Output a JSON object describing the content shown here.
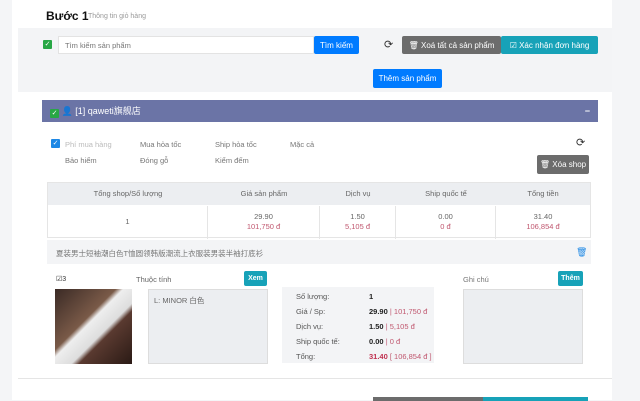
{
  "step": {
    "title": "Bước 1",
    "subtitle": "Thông tin giỏ hàng"
  },
  "search": {
    "placeholder": "Tìm kiếm sản phẩm",
    "button": "Tìm kiếm"
  },
  "toolbar": {
    "delete_all": "Xoá tất cả sản phẩm",
    "confirm": "Xác nhận đơn hàng",
    "add_product": "Thêm sản phẩm"
  },
  "shop": {
    "header": "[1] qaweti旗舰店",
    "collapse": "−",
    "options": [
      {
        "label": "Phí mua hàng",
        "checked": true
      },
      {
        "label": "Mua hỏa tốc",
        "checked": false
      },
      {
        "label": "Ship hỏa tốc",
        "checked": false
      },
      {
        "label": "Mặc cả",
        "checked": false
      },
      {
        "label": "Bảo hiểm",
        "checked": false
      },
      {
        "label": "Đóng gỗ",
        "checked": false
      },
      {
        "label": "Kiểm đếm",
        "checked": false
      }
    ],
    "delete_shop": "Xóa shop",
    "table": {
      "headers": [
        "Tổng shop/Số lượng",
        "Giá sản phẩm",
        "Dịch vụ",
        "Ship quốc tế",
        "Tổng tiền"
      ],
      "row": {
        "qty": "1",
        "price": "29.90",
        "price_vnd": "101,750 đ",
        "service": "1.50",
        "service_vnd": "5,105 đ",
        "ship": "0.00",
        "ship_vnd": "0 đ",
        "total": "31.40",
        "total_vnd": "106,854 đ"
      }
    }
  },
  "product": {
    "title": "夏装男士短袖潮白色T恤圆领韩版潮流上衣服装男装半袖打底衫",
    "checkbox_label": "3",
    "attr_label": "Thuộc tính",
    "view_button": "Xem",
    "attr_value": "L: MINOR 白色",
    "note_label": "Ghi chú",
    "add_note_button": "Thêm",
    "details": [
      {
        "label": "Số lượng:",
        "value": "1",
        "vnd": ""
      },
      {
        "label": "Giá / Sp:",
        "value": "29.90",
        "vnd": "| 101,750 đ"
      },
      {
        "label": "Dịch vụ:",
        "value": "1.50",
        "vnd": "| 5,105 đ"
      },
      {
        "label": "Ship quốc tế:",
        "value": "0.00",
        "vnd": "| 0 đ"
      },
      {
        "label": "Tổng:",
        "value": "31.40",
        "vnd": "[ 106,854 đ ]"
      }
    ]
  },
  "colors": {
    "primary": "#007bff",
    "teal": "#17a2b8",
    "gray": "#6c757d",
    "shop_header": "#6b74a6",
    "check": "#28a745"
  }
}
